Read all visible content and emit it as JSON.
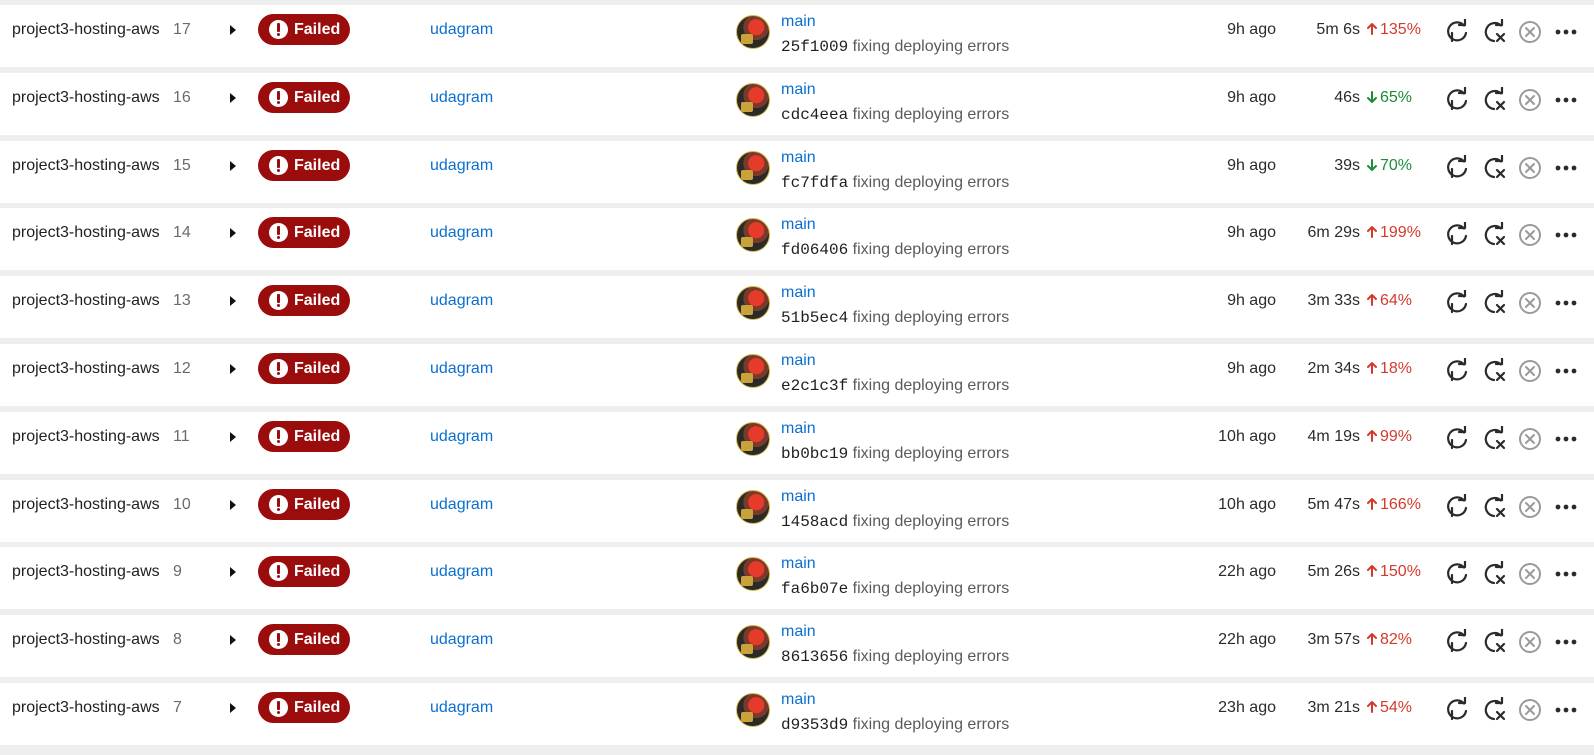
{
  "pipelines": {
    "status_label": "Failed",
    "rows": [
      {
        "project": "project3-hosting-aws",
        "number": "17",
        "workflow": "udagram",
        "branch": "main",
        "commit_hash": "25f1009",
        "commit_message": "fixing deploying errors",
        "started": "9h ago",
        "duration": "5m 6s",
        "delta": "135%",
        "delta_direction": "up"
      },
      {
        "project": "project3-hosting-aws",
        "number": "16",
        "workflow": "udagram",
        "branch": "main",
        "commit_hash": "cdc4eea",
        "commit_message": "fixing deploying errors",
        "started": "9h ago",
        "duration": "46s",
        "delta": "65%",
        "delta_direction": "down"
      },
      {
        "project": "project3-hosting-aws",
        "number": "15",
        "workflow": "udagram",
        "branch": "main",
        "commit_hash": "fc7fdfa",
        "commit_message": "fixing deploying errors",
        "started": "9h ago",
        "duration": "39s",
        "delta": "70%",
        "delta_direction": "down"
      },
      {
        "project": "project3-hosting-aws",
        "number": "14",
        "workflow": "udagram",
        "branch": "main",
        "commit_hash": "fd06406",
        "commit_message": "fixing deploying errors",
        "started": "9h ago",
        "duration": "6m 29s",
        "delta": "199%",
        "delta_direction": "up"
      },
      {
        "project": "project3-hosting-aws",
        "number": "13",
        "workflow": "udagram",
        "branch": "main",
        "commit_hash": "51b5ec4",
        "commit_message": "fixing deploying errors",
        "started": "9h ago",
        "duration": "3m 33s",
        "delta": "64%",
        "delta_direction": "up"
      },
      {
        "project": "project3-hosting-aws",
        "number": "12",
        "workflow": "udagram",
        "branch": "main",
        "commit_hash": "e2c1c3f",
        "commit_message": "fixing deploying errors",
        "started": "9h ago",
        "duration": "2m 34s",
        "delta": "18%",
        "delta_direction": "up"
      },
      {
        "project": "project3-hosting-aws",
        "number": "11",
        "workflow": "udagram",
        "branch": "main",
        "commit_hash": "bb0bc19",
        "commit_message": "fixing deploying errors",
        "started": "10h ago",
        "duration": "4m 19s",
        "delta": "99%",
        "delta_direction": "up"
      },
      {
        "project": "project3-hosting-aws",
        "number": "10",
        "workflow": "udagram",
        "branch": "main",
        "commit_hash": "1458acd",
        "commit_message": "fixing deploying errors",
        "started": "10h ago",
        "duration": "5m 47s",
        "delta": "166%",
        "delta_direction": "up"
      },
      {
        "project": "project3-hosting-aws",
        "number": "9",
        "workflow": "udagram",
        "branch": "main",
        "commit_hash": "fa6b07e",
        "commit_message": "fixing deploying errors",
        "started": "22h ago",
        "duration": "5m 26s",
        "delta": "150%",
        "delta_direction": "up"
      },
      {
        "project": "project3-hosting-aws",
        "number": "8",
        "workflow": "udagram",
        "branch": "main",
        "commit_hash": "8613656",
        "commit_message": "fixing deploying errors",
        "started": "22h ago",
        "duration": "3m 57s",
        "delta": "82%",
        "delta_direction": "up"
      },
      {
        "project": "project3-hosting-aws",
        "number": "7",
        "workflow": "udagram",
        "branch": "main",
        "commit_hash": "d9353d9",
        "commit_message": "fixing deploying errors",
        "started": "23h ago",
        "duration": "3m 21s",
        "delta": "54%",
        "delta_direction": "up"
      }
    ]
  },
  "colors": {
    "failed_badge": "#9b0d0d",
    "link": "#0b6fcf",
    "delta_up": "#d33a2c",
    "delta_down": "#1d8b37",
    "row_background": "#ffffff",
    "page_background": "#eeeeee"
  },
  "icons": {
    "expand": "caret-right-icon",
    "status": "exclamation-circle-icon",
    "rerun": "rerun-icon",
    "rerun_failed": "rerun-failed-icon",
    "cancel": "cancel-icon",
    "more": "more-icon",
    "delta_up": "arrow-up-icon",
    "delta_down": "arrow-down-icon"
  }
}
